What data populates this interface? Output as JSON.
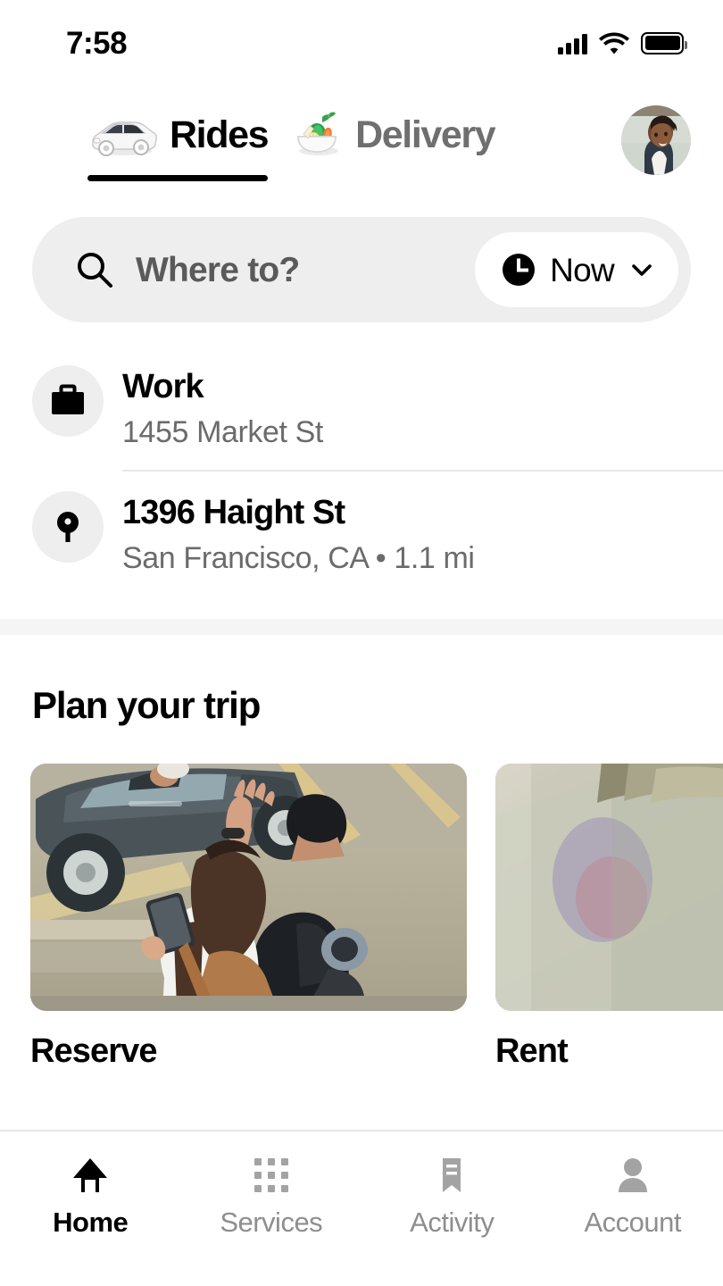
{
  "status_bar": {
    "time": "7:58",
    "signal_icon": "cellular-signal-icon",
    "wifi_icon": "wifi-icon",
    "battery_icon": "battery-icon"
  },
  "mode_tabs": [
    {
      "label": "Rides",
      "emoji_name": "car-emoji",
      "active": true
    },
    {
      "label": "Delivery",
      "emoji_name": "food-bowl-emoji",
      "active": false
    }
  ],
  "avatar": {
    "name": "profile-avatar",
    "alt": "User profile photo"
  },
  "search": {
    "placeholder": "Where to?",
    "value": "",
    "icon": "search-icon",
    "time_picker": {
      "label": "Now",
      "icon": "clock-icon",
      "chevron": "chevron-down-icon"
    }
  },
  "saved_places": [
    {
      "icon": "briefcase-icon",
      "title": "Work",
      "subtitle": "1455 Market St"
    },
    {
      "icon": "map-pin-icon",
      "title": "1396 Haight St",
      "subtitle": "San Francisco, CA  •  1.1 mi"
    }
  ],
  "plan_section": {
    "title": "Plan your trip",
    "cards": [
      {
        "label": "Reserve",
        "image_name": "reserve-card-image"
      },
      {
        "label": "Rent",
        "image_name": "rent-card-image"
      }
    ]
  },
  "bottom_nav": [
    {
      "label": "Home",
      "icon": "home-icon",
      "active": true
    },
    {
      "label": "Services",
      "icon": "grid-dots-icon",
      "active": false
    },
    {
      "label": "Activity",
      "icon": "receipt-icon",
      "active": false
    },
    {
      "label": "Account",
      "icon": "person-icon",
      "active": false
    }
  ],
  "colors": {
    "background": "#ffffff",
    "search_field": "#eeeeee",
    "separator_band": "#f5f5f5",
    "divider": "#e8e8e8",
    "active_text": "#000000",
    "inactive_text": "#8e8e8e",
    "muted_text": "#6b6b6b"
  }
}
